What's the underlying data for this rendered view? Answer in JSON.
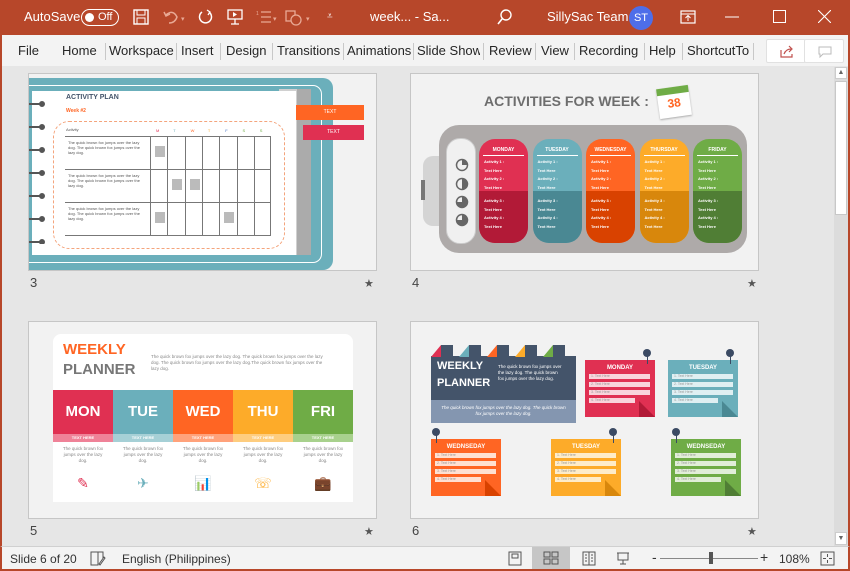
{
  "titlebar": {
    "autosave_label": "AutoSave",
    "autosave_state": "Off",
    "doc_title": "week... - Sa...",
    "user_name": "SillySac Team",
    "user_initials": "ST",
    "icons": [
      "save-icon",
      "undo-icon",
      "redo-icon",
      "present-icon",
      "numbering-icon",
      "shapes-icon",
      "customize-qat-icon",
      "search-icon",
      "ribbon-display-icon",
      "minimize-icon",
      "maximize-icon",
      "close-icon"
    ]
  },
  "ribbon": {
    "tabs": [
      "File",
      "Home",
      "Workspace",
      "Insert",
      "Design",
      "Transitions",
      "Animations",
      "Slide Show",
      "Review",
      "View",
      "Recording",
      "Help",
      "ShortcutTo"
    ],
    "share_icon": "share-icon",
    "comments_icon": "comments-icon"
  },
  "slides": [
    {
      "number": "3",
      "title": "ACTIVITY PLAN",
      "subtitle": "Week #2",
      "table_header": "Activity",
      "days": [
        "M",
        "T",
        "W",
        "T",
        "F",
        "S",
        "S"
      ],
      "row_text": "The quick brown fox jumps over the lazy dog. The quick brown fox jumps over the lazy dog.",
      "tags": [
        "TEXT",
        "TEXT"
      ]
    },
    {
      "number": "4",
      "title": "ACTIVITIES FOR WEEK :",
      "week_number": "38",
      "days": [
        "MONDAY",
        "TUESDAY",
        "WEDNESDAY",
        "THURSDAY",
        "FRIDAY"
      ],
      "items": [
        "Activity 1 :",
        "Text Here",
        "Activity 2 :",
        "Text Here",
        "Activity 3 :",
        "Text Here",
        "Activity 4 :",
        "Text Here"
      ]
    },
    {
      "number": "5",
      "title_1": "WEEKLY",
      "title_2": "PLANNER",
      "intro": "The quick brown fox jumps over the lazy dog. The quick brown fox jumps over the lazy dog. The quick brown fox jumps over the lazy dog.The quick brown fox jumps over the lazy dog.",
      "days": [
        "MON",
        "TUE",
        "WED",
        "THU",
        "FRI"
      ],
      "tag": "TEXT HERE",
      "body": "The quick brown fox jumps over the lazy dog."
    },
    {
      "number": "6",
      "title_1": "WEEKLY",
      "title_2": "PLANNER",
      "intro": "The quick brown fox jumps over the lazy dog. The quick brown fox jumps over the lazy dog.",
      "footer": "The quick brown fox jumps over the lazy dog. The quick brown fox jumps over the lazy dog.",
      "notes": [
        "MONDAY",
        "TUESDAY",
        "WEDNSEDAY",
        "TUESDAY",
        "WEDNSEDAY"
      ],
      "lines": [
        "1. Text Here",
        "2. Text Here",
        "3. Text Here",
        "4. Text Here"
      ]
    }
  ],
  "colors": {
    "red": "#e03052",
    "teal": "#6bafbb",
    "orange": "#ff6523",
    "yellow": "#fdab29",
    "green": "#6fac46",
    "navy": "#44546a"
  },
  "status": {
    "slide_info": "Slide 6 of 20",
    "language": "English (Philippines)",
    "zoom_level": "108%",
    "zoom_minus": "-",
    "zoom_plus": "+"
  }
}
